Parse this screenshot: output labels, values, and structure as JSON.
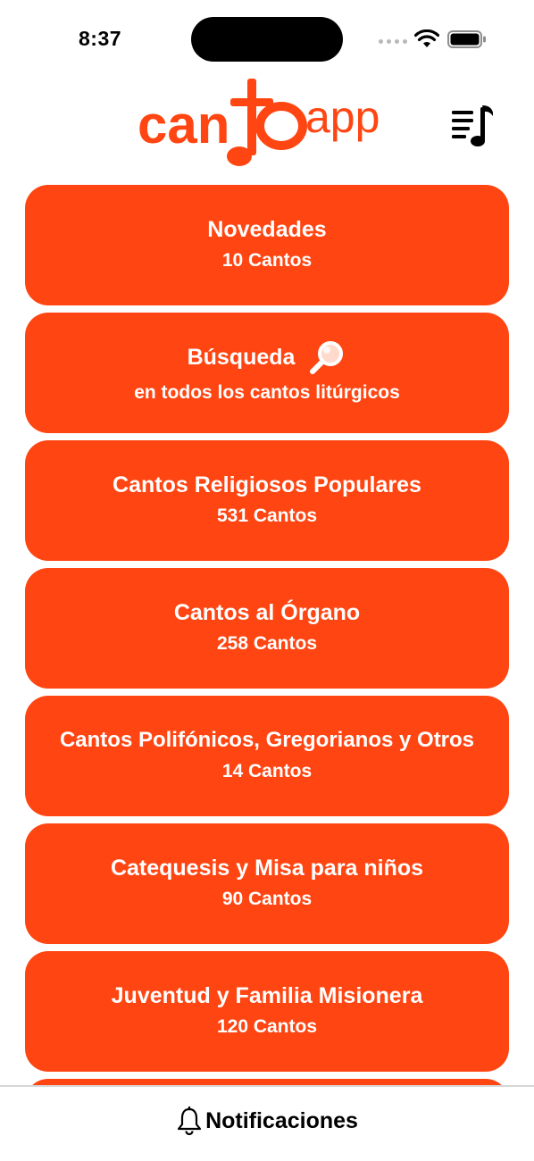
{
  "status_bar": {
    "time": "8:37"
  },
  "header": {
    "logo_text": "cantoapp",
    "logo_part1": "can",
    "logo_part2": "to",
    "logo_part3": "app",
    "playlist_icon": "music-list-icon"
  },
  "colors": {
    "accent": "#ff4512",
    "background": "#ffffff",
    "text_on_accent": "#ffffff"
  },
  "menu": {
    "items": [
      {
        "title": "Novedades",
        "subtitle": "10 Cantos"
      },
      {
        "title": "Búsqueda",
        "subtitle": "en todos los cantos litúrgicos",
        "icon": "magnifier-icon"
      },
      {
        "title": "Cantos Religiosos Populares",
        "subtitle": "531 Cantos"
      },
      {
        "title": "Cantos al Órgano",
        "subtitle": "258 Cantos"
      },
      {
        "title": "Cantos Polifónicos, Gregorianos y Otros",
        "subtitle": "14 Cantos"
      },
      {
        "title": "Catequesis y Misa para niños",
        "subtitle": "90 Cantos"
      },
      {
        "title": "Juventud y Familia Misionera",
        "subtitle": "120 Cantos"
      }
    ]
  },
  "bottom_bar": {
    "notifications_label": "Notificaciones",
    "icon": "bell-icon"
  }
}
